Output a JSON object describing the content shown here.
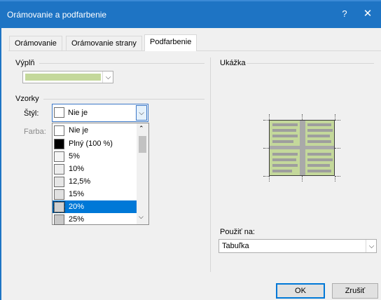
{
  "window": {
    "title": "Orámovanie a podfarbenie",
    "help_label": "?",
    "close_label": "✕"
  },
  "tabs": [
    {
      "label": "Orámovanie",
      "active": false
    },
    {
      "label": "Orámovanie strany",
      "active": false
    },
    {
      "label": "Podfarbenie",
      "active": true
    }
  ],
  "fill": {
    "label": "Výplň",
    "color": "#c4d89b"
  },
  "patterns": {
    "group_label": "Vzorky",
    "style_label": "Štýl:",
    "style_value": "Nie je",
    "color_label": "Farba:",
    "options": [
      {
        "label": "Nie je",
        "swatch": "#ffffff",
        "selected": false
      },
      {
        "label": "Plný (100 %)",
        "swatch": "#000000",
        "selected": false
      },
      {
        "label": "5%",
        "swatch": "#f5f5f5",
        "selected": false
      },
      {
        "label": "10%",
        "swatch": "#eeeeee",
        "selected": false
      },
      {
        "label": "12,5%",
        "swatch": "#e6e6e6",
        "selected": false
      },
      {
        "label": "15%",
        "swatch": "#e0e0e0",
        "selected": false
      },
      {
        "label": "20%",
        "swatch": "#d0d0d0",
        "selected": true
      },
      {
        "label": "25%",
        "swatch": "#c8c8c8",
        "selected": false
      }
    ]
  },
  "preview": {
    "label": "Ukážka"
  },
  "apply_to": {
    "label": "Použiť na:",
    "value": "Tabuľka"
  },
  "buttons": {
    "ok": "OK",
    "cancel": "Zrušiť"
  }
}
